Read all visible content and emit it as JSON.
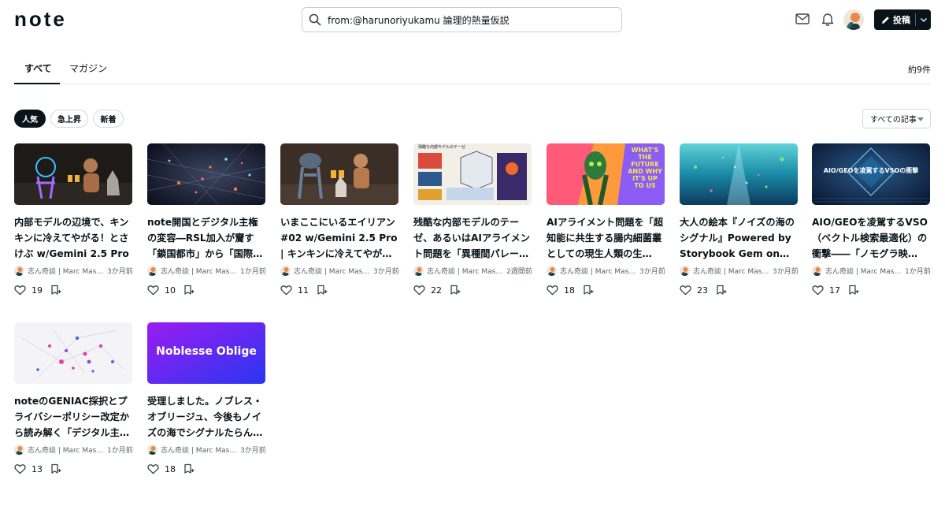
{
  "header": {
    "logo": "note",
    "search_query": "from:@harunoriyukamu 論理的熱量仮説",
    "post_label": "投稿",
    "icons": [
      "search-icon",
      "mail-icon",
      "bell-icon",
      "pen-icon",
      "chevron-down-icon"
    ]
  },
  "tabs": [
    {
      "label": "すべて",
      "active": true
    },
    {
      "label": "マガジン",
      "active": false
    }
  ],
  "result_count": "約9件",
  "filters": [
    {
      "label": "人気",
      "active": true
    },
    {
      "label": "急上昇",
      "active": false
    },
    {
      "label": "新着",
      "active": false
    }
  ],
  "sort": {
    "selected": "すべての記事"
  },
  "cards": [
    {
      "title": "内部モデルの辺境で、キンキンに冷えてやがる！とさけぶ w/Gemini 2.5 Pro",
      "author": "志ん奇談 | Marc Mas…",
      "time": "3か月前",
      "likes": "19",
      "thumb_text": ""
    },
    {
      "title": "note開国とデジタル主権の変容―RSL加入が齎す「鎖国都市」から「国際連…",
      "author": "志ん奇談 | Marc Mas…",
      "time": "1か月前",
      "likes": "10",
      "thumb_text": ""
    },
    {
      "title": "いまここにいるエイリアン #02 w/Gemini 2.5 Pro | キンキンに冷えてやがる…",
      "author": "志ん奇談 | Marc Mas…",
      "time": "3か月前",
      "likes": "11",
      "thumb_text": ""
    },
    {
      "title": "残酷な内部モデルのテーゼ、あるいはAIアライメント問題を「異種間パレー…",
      "author": "志ん奇談 | Marc Mas…",
      "time": "2週間前",
      "likes": "22",
      "thumb_text": "残酷な内部モデルのテーゼ"
    },
    {
      "title": "AIアライメント問題を「超知能に共生する腸内細菌叢としての現生人類の生…",
      "author": "志ん奇談 | Marc Mas…",
      "time": "3か月前",
      "likes": "18",
      "thumb_text": "WHAT'S THE FUTURE AND WHY IT'S UP TO US"
    },
    {
      "title": "大人の絵本『ノイズの海のシグナル』Powered by Storybook Gem on…",
      "author": "志ん奇談 | Marc Mas…",
      "time": "3か月前",
      "likes": "23",
      "thumb_text": ""
    },
    {
      "title": "AIO/GEOを凌駕するVSO（ベクトル検索最適化）の衝撃――「ノモグラ映え」…",
      "author": "志ん奇談 | Marc Mas…",
      "time": "1か月前",
      "likes": "17",
      "thumb_text": "AIO/GEOを凌駕するVSOの衝撃"
    },
    {
      "title": "noteのGENIAC採択とプライバシーポリシー改定から読み解く「デジタル主…",
      "author": "志ん奇談 | Marc Mas…",
      "time": "1か月前",
      "likes": "13",
      "thumb_text": ""
    },
    {
      "title": "受理しました。ノブレス・オブリージュ、今後もノイズの海でシグナルたらんこ…",
      "author": "志ん奇談 | Marc Mas…",
      "time": "3か月前",
      "likes": "18",
      "thumb_text": "Noblesse Oblige"
    }
  ],
  "colors": {
    "text": "#08131a",
    "muted": "#5a646b",
    "border": "#d4d8db",
    "noblesse_from": "#9b1cf0",
    "noblesse_to": "#2a36f2"
  }
}
